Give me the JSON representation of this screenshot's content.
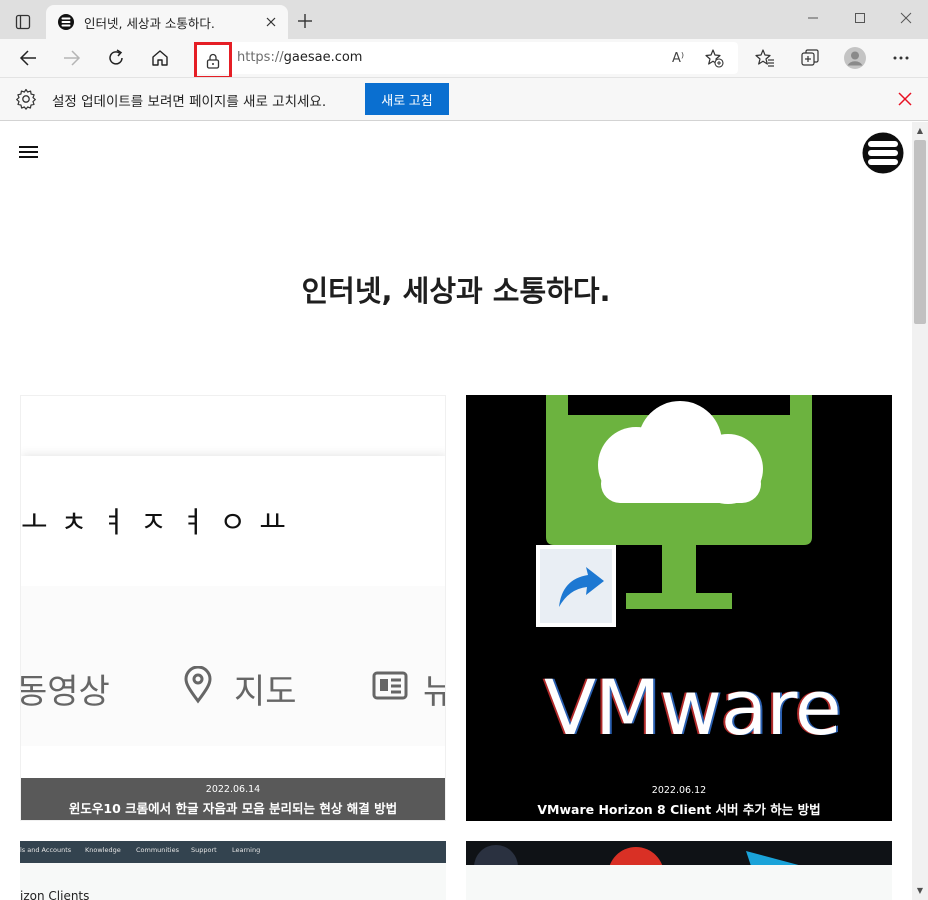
{
  "browser": {
    "tab": {
      "title": "인터넷, 세상과 소통하다."
    },
    "address": {
      "scheme": "https://",
      "host": "gaesae.com"
    },
    "read_aloud_glyph": "A⁾"
  },
  "infobar": {
    "message": "설정 업데이트를 보려면 페이지를 새로 고치세요.",
    "refresh_label": "새로 고침"
  },
  "page": {
    "site_title": "인터넷, 세상과 소통하다.",
    "cards": [
      {
        "date": "2022.06.14",
        "title": "윈도우10 크롬에서 한글 자음과 모음 분리되는 현상 해결 방법",
        "thumb_jamo": "ㅗㅊㅕㅈㅕㅇㅛ",
        "thumb_tabs": [
          "동영상",
          "지도",
          "뉴"
        ]
      },
      {
        "date": "2022.06.12",
        "title": "VMware Horizon 8 Client 서버 추가 하는 방법",
        "thumb_brand": "VMware"
      },
      {
        "thumb_nav": [
          "ls and Accounts",
          "Knowledge",
          "Communities",
          "Support",
          "Learning"
        ],
        "thumb_heading": "izon Clients"
      },
      {}
    ]
  },
  "colors": {
    "accent": "#0a6fd0",
    "lock_highlight": "#e51e25",
    "close_red": "#e81123",
    "vmware_green": "#6cb33f"
  }
}
